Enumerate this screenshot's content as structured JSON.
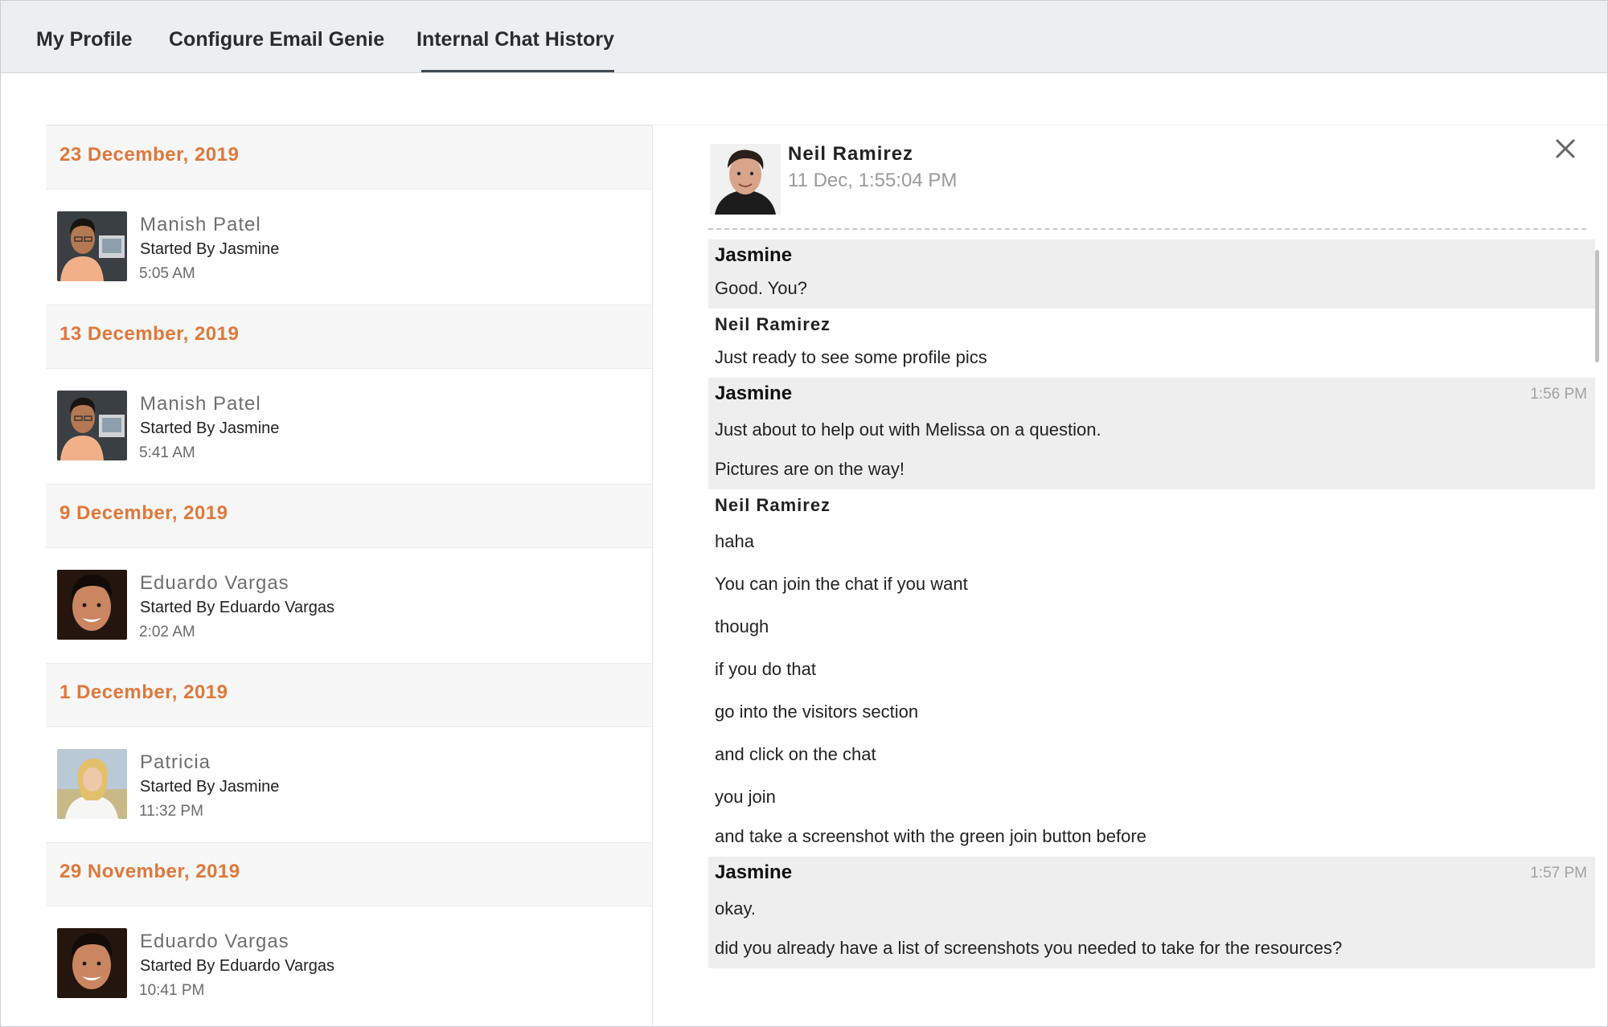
{
  "tabs": {
    "my_profile": "My Profile",
    "configure_email_genie": "Configure Email Genie",
    "internal_chat_history": "Internal Chat History"
  },
  "history": [
    {
      "date": "23 December, 2019",
      "name": "Manish Patel",
      "started": "Started By Jasmine",
      "time": "5:05 AM",
      "avatar": "manish"
    },
    {
      "date": "13 December, 2019",
      "name": "Manish Patel",
      "started": "Started By Jasmine",
      "time": "5:41 AM",
      "avatar": "manish"
    },
    {
      "date": "9 December, 2019",
      "name": "Eduardo Vargas",
      "started": "Started By Eduardo Vargas",
      "time": "2:02 AM",
      "avatar": "eduardo"
    },
    {
      "date": "1 December, 2019",
      "name": "Patricia",
      "started": "Started By Jasmine",
      "time": "11:32 PM",
      "avatar": "patricia"
    },
    {
      "date": "29 November, 2019",
      "name": "Eduardo Vargas",
      "started": "Started By Eduardo Vargas",
      "time": "10:41 PM",
      "avatar": "eduardo"
    }
  ],
  "conversation": {
    "header_name": "Neil Ramirez",
    "header_time": "11 Dec, 1:55:04 PM",
    "messages": [
      {
        "sender": "Jasmine",
        "self": true,
        "stamp": "",
        "lines": [
          "Good. You?"
        ]
      },
      {
        "sender": "Neil Ramirez",
        "self": false,
        "stamp": "",
        "lines": [
          "Just ready to see some profile pics"
        ]
      },
      {
        "sender": "Jasmine",
        "self": true,
        "stamp": "1:56 PM",
        "lines": [
          "Just about to help out with Melissa on a question.",
          "Pictures are on the way!"
        ]
      },
      {
        "sender": "Neil Ramirez",
        "self": false,
        "stamp": "",
        "lines": [
          "haha",
          "You can join the chat if you want",
          "though",
          "if you do that",
          "go into the visitors section",
          "and click on the chat",
          "you join",
          "and take a screenshot with the green join button before"
        ]
      },
      {
        "sender": "Jasmine",
        "self": true,
        "stamp": "1:57 PM",
        "lines": [
          "okay.",
          "did you already have a list of screenshots you needed to take for the resources?"
        ]
      }
    ]
  },
  "colors": {
    "date_accent": "#e0783b",
    "tab_bar": "#eceff2",
    "self_message_bg": "#eeeeee"
  },
  "icons": {
    "close": "close-icon"
  }
}
